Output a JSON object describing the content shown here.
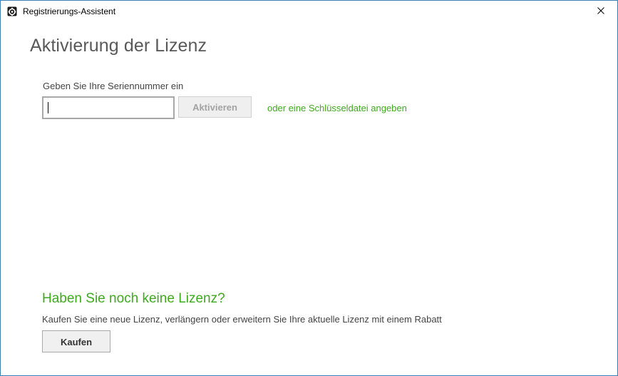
{
  "window": {
    "title": "Registrierungs-Assistent",
    "app_icon": "gear-icon",
    "close_icon": "close-icon",
    "border_color": "#3c7fb1"
  },
  "activation": {
    "heading": "Aktivierung der Lizenz",
    "serial_label": "Geben Sie Ihre Seriennummer ein",
    "serial_value": "",
    "activate_label": "Aktivieren",
    "activate_enabled": false,
    "keyfile_link": "oder eine Schlüsseldatei angeben"
  },
  "purchase": {
    "heading": "Haben Sie noch keine Lizenz?",
    "description": "Kaufen Sie eine neue Lizenz, verlängern oder erweitern Sie Ihre aktuelle Lizenz mit einem Rabatt",
    "buy_label": "Kaufen"
  },
  "colors": {
    "accent_green": "#3fa91f",
    "heading_gray": "#595959",
    "text_gray": "#444444"
  }
}
